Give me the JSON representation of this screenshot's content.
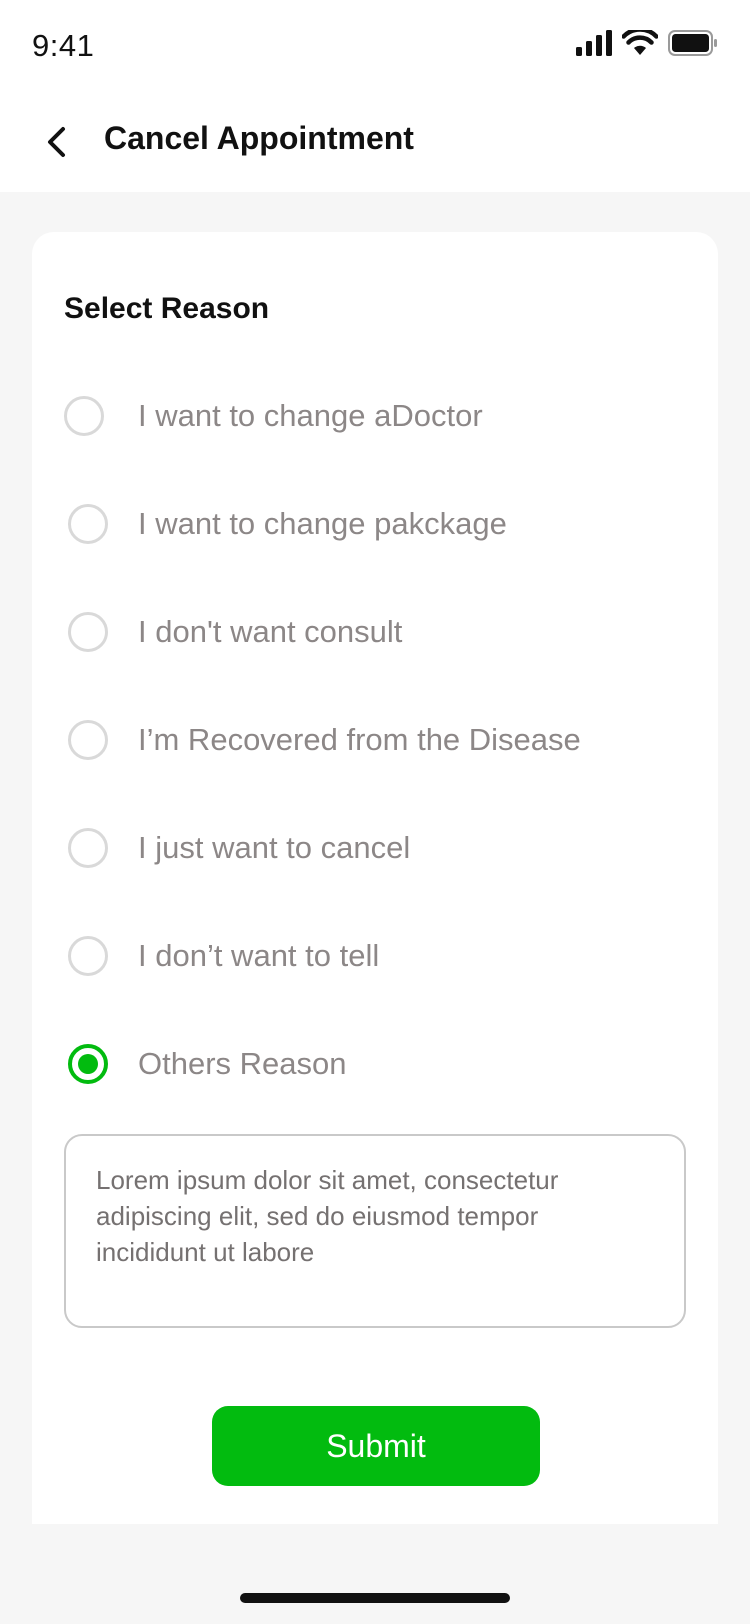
{
  "status_bar": {
    "time": "9:41",
    "icons": [
      "cellular-signal-icon",
      "wifi-icon",
      "battery-icon"
    ]
  },
  "header": {
    "back_icon": "chevron-left-icon",
    "title": "Cancel Appointment"
  },
  "form": {
    "section_title": "Select Reason",
    "options": [
      {
        "label": "I want to change aDoctor",
        "selected": false
      },
      {
        "label": "I want to change pakckage",
        "selected": false
      },
      {
        "label": "I don't want consult",
        "selected": false
      },
      {
        "label": "I’m Recovered from the Disease",
        "selected": false
      },
      {
        "label": "I just want to cancel",
        "selected": false
      },
      {
        "label": "I don’t want to tell",
        "selected": false
      },
      {
        "label": "Others Reason",
        "selected": true
      }
    ],
    "reason_text": "Lorem ipsum dolor sit amet, consectetur adipiscing elit, sed do eiusmod tempor incididunt ut labore",
    "submit_label": "Submit"
  },
  "colors": {
    "accent": "#02bb0f",
    "option_text": "#8c8787",
    "background": "#f6f6f6"
  }
}
